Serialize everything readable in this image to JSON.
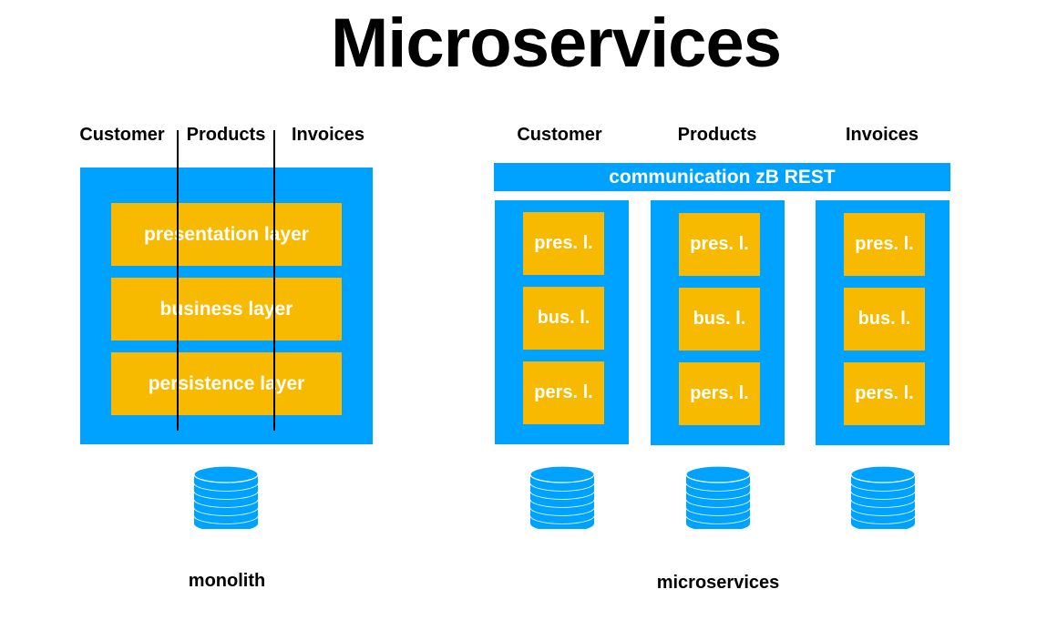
{
  "title": "Microservices",
  "colors": {
    "container_blue": "#00a2ff",
    "layer_yellow": "#f8ba00",
    "layer_text": "#ffffff",
    "text": "#000000"
  },
  "monolith": {
    "columns": [
      "Customer",
      "Products",
      "Invoices"
    ],
    "layers": [
      "presentation layer",
      "business layer",
      "persistence layer"
    ],
    "database_icon": "database-icon",
    "caption": "monolith"
  },
  "microservices": {
    "columns": [
      "Customer",
      "Products",
      "Invoices"
    ],
    "communication_bar": "communication zB REST",
    "services": [
      {
        "name": "Customer",
        "layers": [
          "pres. l.",
          "bus. l.",
          "pers. l."
        ]
      },
      {
        "name": "Products",
        "layers": [
          "pres. l.",
          "bus. l.",
          "pers. l."
        ]
      },
      {
        "name": "Invoices",
        "layers": [
          "pres. l.",
          "bus. l.",
          "pers. l."
        ]
      }
    ],
    "database_icon": "database-icon",
    "caption": "microservices"
  }
}
